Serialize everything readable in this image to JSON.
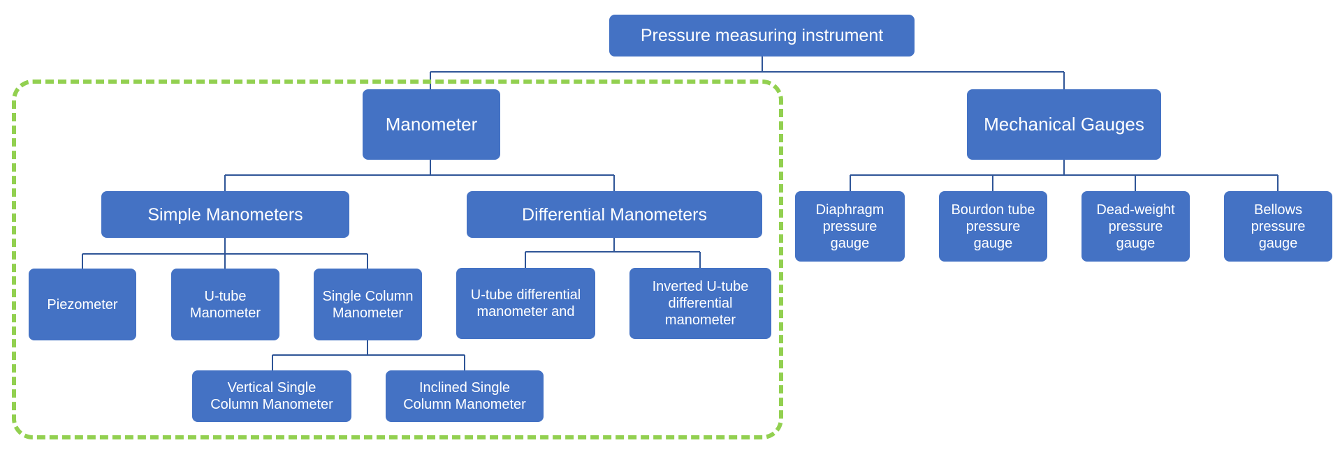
{
  "diagram": {
    "root": "Pressure measuring  instrument",
    "highlight_group": "manometer-branch",
    "colors": {
      "node_fill": "#4472c4",
      "node_text": "#ffffff",
      "connector": "#2f5597",
      "highlight": "#92d050"
    },
    "manometer": {
      "label": "Manometer",
      "simple": {
        "label": "Simple Manometers",
        "children": [
          "Piezometer",
          "U-tube\nManometer",
          "Single Column\nManometer"
        ],
        "single_column_children": [
          "Vertical Single\nColumn Manometer",
          "Inclined Single\nColumn Manometer"
        ]
      },
      "differential": {
        "label": "Differential Manometers",
        "children": [
          "U-tube differential\nmanometer and",
          "Inverted U-tube\ndifferential\nmanometer"
        ]
      }
    },
    "mechanical": {
      "label": "Mechanical Gauges",
      "children": [
        "Diaphragm\npressure\ngauge",
        "Bourdon tube\npressure\ngauge",
        "Dead-weight\npressure\ngauge",
        "Bellows\npressure\ngauge"
      ]
    }
  }
}
